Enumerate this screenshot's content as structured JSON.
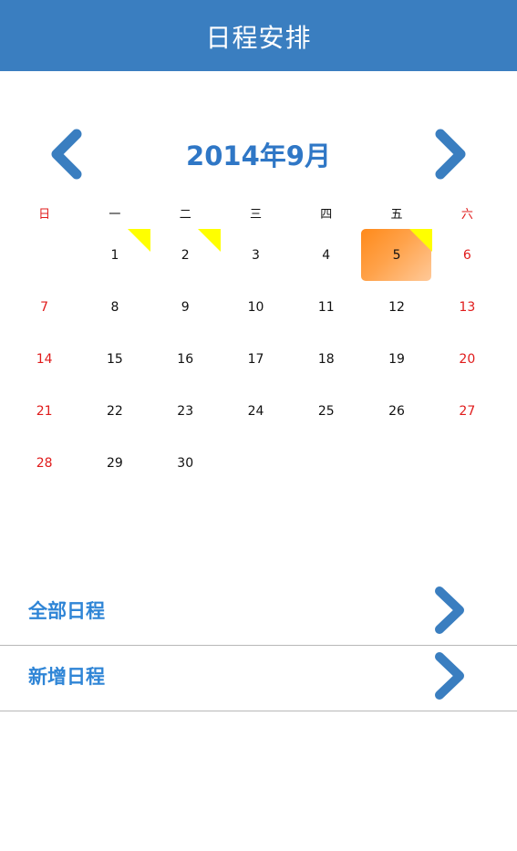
{
  "header": {
    "title": "日程安排"
  },
  "calendar": {
    "month_title": "2014年9月",
    "weekdays": [
      "日",
      "一",
      "二",
      "三",
      "四",
      "五",
      "六"
    ],
    "weeks": [
      [
        "",
        "1",
        "2",
        "3",
        "4",
        "5",
        "6"
      ],
      [
        "7",
        "8",
        "9",
        "10",
        "11",
        "12",
        "13"
      ],
      [
        "14",
        "15",
        "16",
        "17",
        "18",
        "19",
        "20"
      ],
      [
        "21",
        "22",
        "23",
        "24",
        "25",
        "26",
        "27"
      ],
      [
        "28",
        "29",
        "30",
        "",
        "",
        "",
        ""
      ]
    ],
    "today": "5",
    "marked_days": [
      "1",
      "2",
      "5"
    ],
    "colors": {
      "weekend": "#e01b1b",
      "marker": "#ffff00",
      "today_start": "#ff8a1a",
      "today_end": "#ffc999",
      "accent": "#2f77c6"
    }
  },
  "icons": {
    "prev": "chevron-left-icon",
    "next": "chevron-right-icon"
  },
  "menu": {
    "items": [
      {
        "label": "全部日程",
        "icon": "chevron-right-icon"
      },
      {
        "label": "新增日程",
        "icon": "chevron-right-icon"
      }
    ]
  },
  "theme": {
    "header_bg": "#3a7ec0",
    "link_color": "#2f85d6"
  }
}
